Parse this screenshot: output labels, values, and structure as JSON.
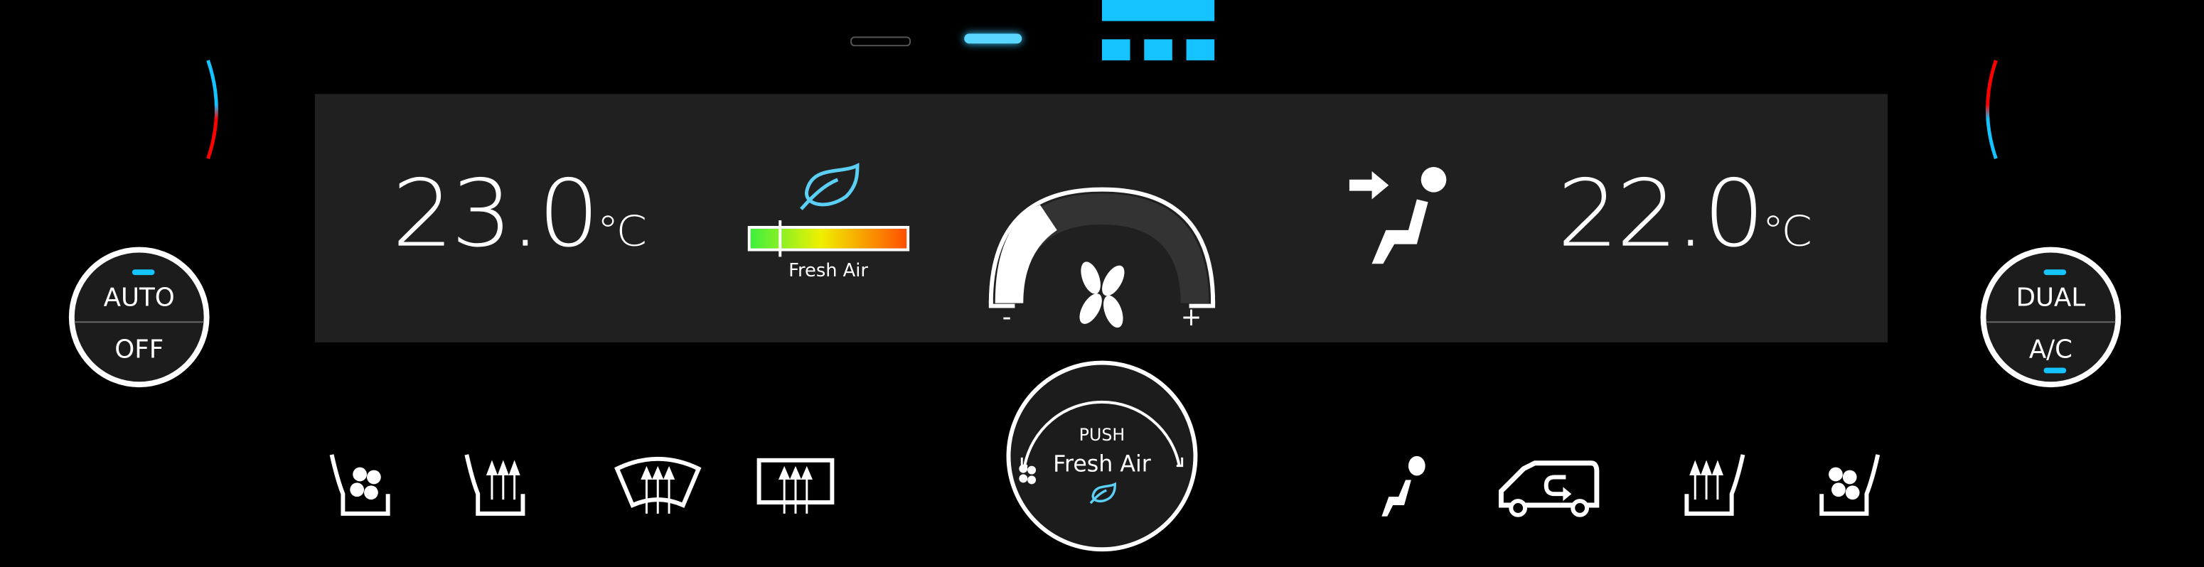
{
  "top_indicators": {
    "page_dots": [
      "inactive",
      "active"
    ],
    "fan_level_bars": 3,
    "accent": "#14c3ff"
  },
  "left_zone": {
    "temperature": "23.0",
    "unit": "°C",
    "temp_arc": "cool-to-warm"
  },
  "right_zone": {
    "temperature": "22.0",
    "unit": "°C",
    "temp_arc": "warm-to-cool"
  },
  "air_quality": {
    "icon": "leaf-icon",
    "label": "Fresh Air",
    "level": 0.2,
    "gradient": [
      "#3ef03e",
      "#f0f000",
      "#ff5000"
    ]
  },
  "fan_gauge": {
    "minus": "-",
    "plus": "+",
    "level": 1,
    "max_level": 5
  },
  "left_knob": {
    "top_label": "AUTO",
    "bottom_label": "OFF"
  },
  "right_knob": {
    "top_label": "DUAL",
    "bottom_label": "A/C"
  },
  "center_knob": {
    "push_label": "PUSH",
    "mode_label": "Fresh Air"
  },
  "bottom_buttons": [
    "seat-ventilation-left",
    "seat-heat-left",
    "windshield-defrost",
    "rear-defrost",
    "airflow-face",
    "recirculation",
    "seat-heat-right",
    "seat-ventilation-right"
  ],
  "colors": {
    "panel": "#202020",
    "accent": "#14c3ff",
    "leaf": "#5ccff5",
    "hot": "#ff0000"
  }
}
